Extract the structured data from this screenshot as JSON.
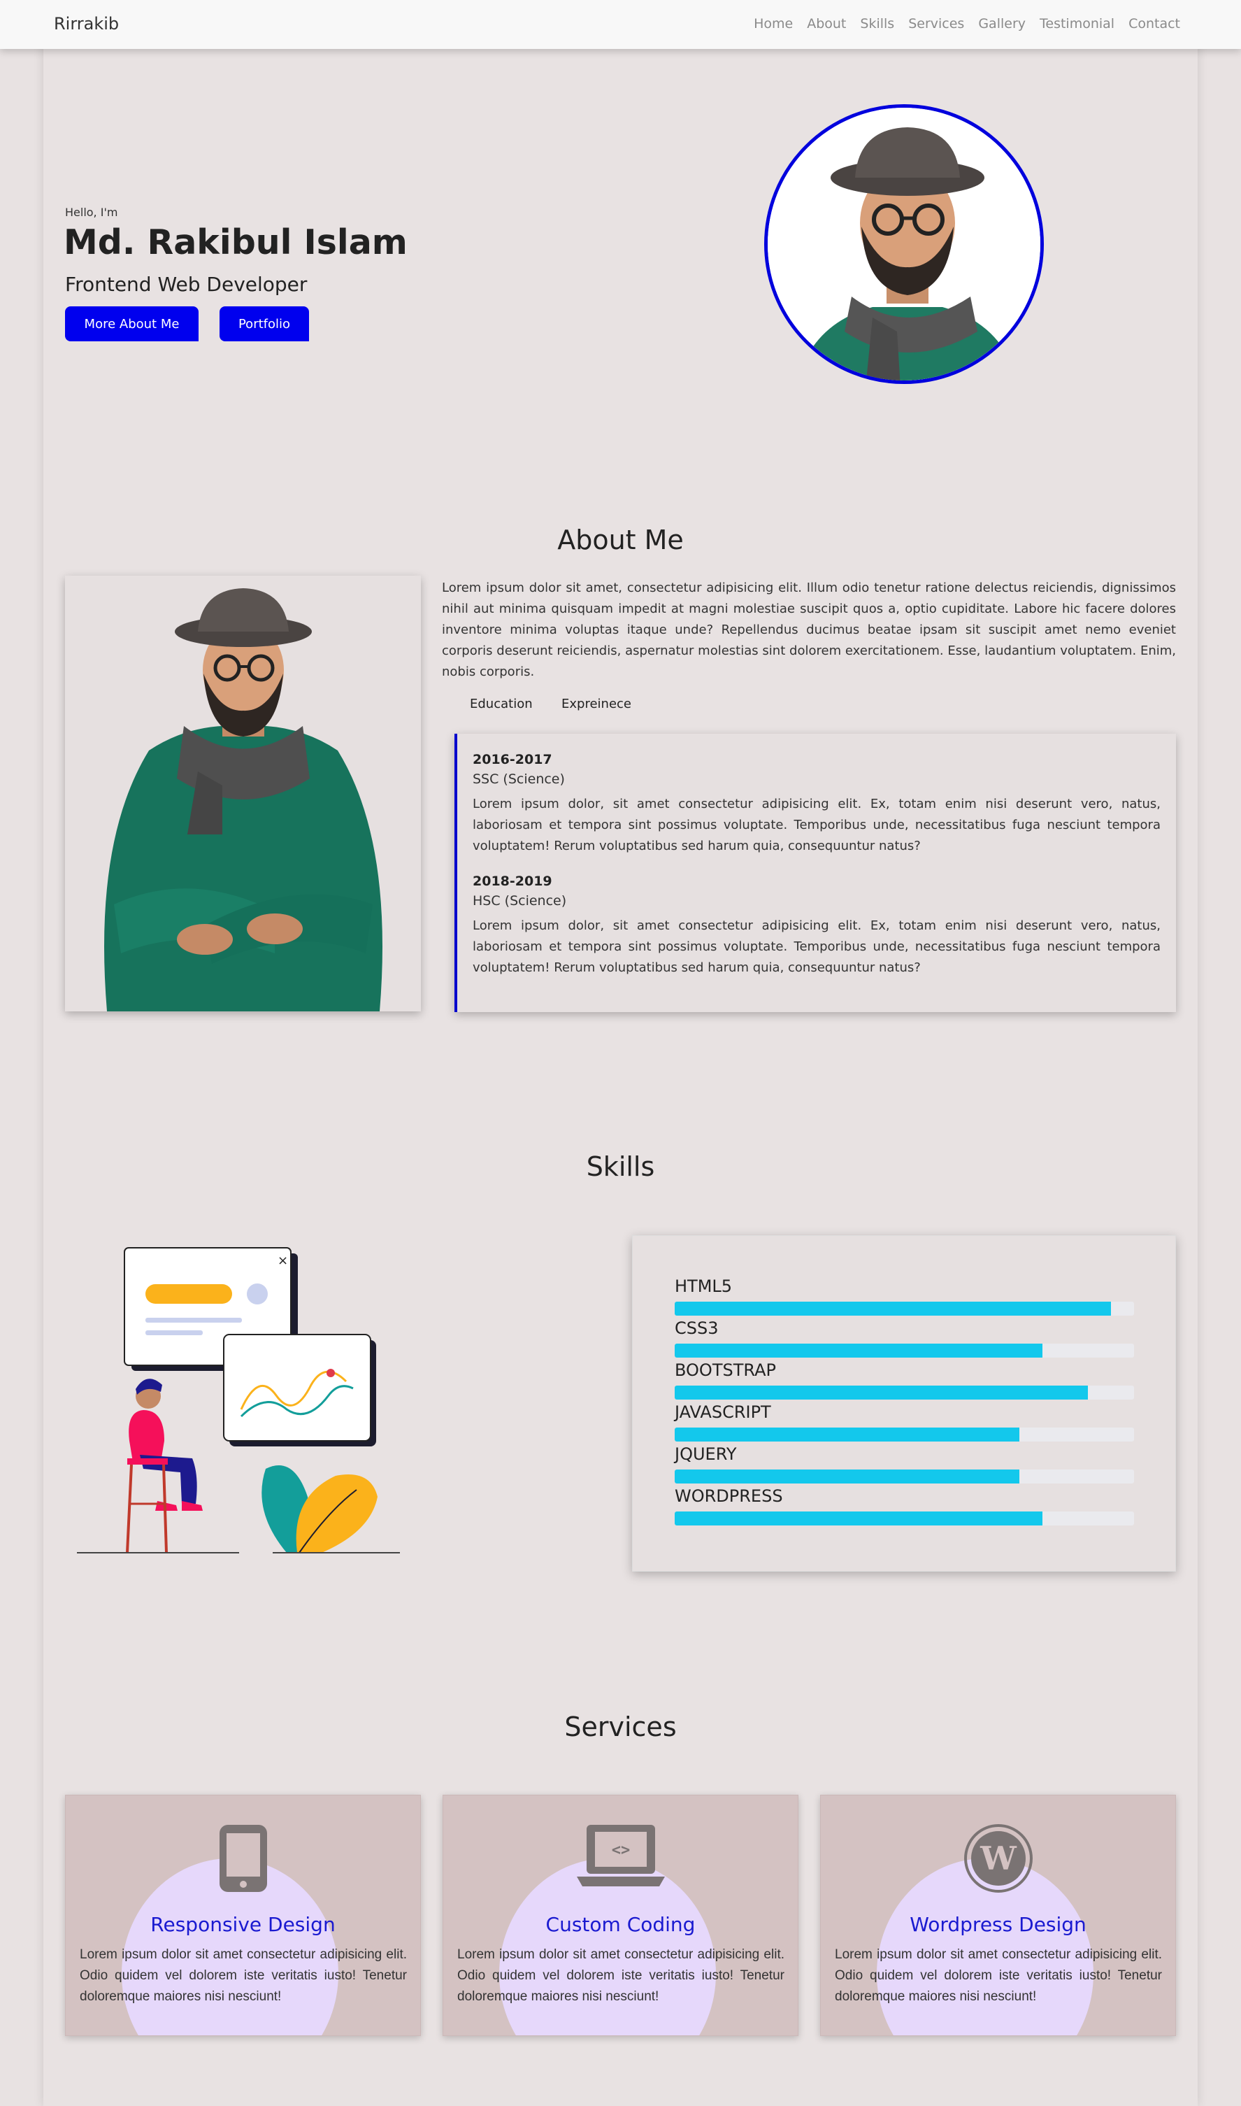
{
  "nav": {
    "brand": "Rirrakib",
    "links": [
      "Home",
      "About",
      "Skills",
      "Services",
      "Gallery",
      "Testimonial",
      "Contact"
    ]
  },
  "hero": {
    "greeting": "Hello, I'm",
    "name": "Md. Rakibul Islam",
    "role": "Frontend Web Developer",
    "more_button": "More About Me",
    "portfolio_button": "Portfolio"
  },
  "about": {
    "title": "About Me",
    "text": "Lorem ipsum dolor sit amet, consectetur adipisicing elit. Illum odio tenetur ratione delectus reiciendis, dignissimos nihil aut minima quisquam impedit at magni molestiae suscipit quos a, optio cupiditate. Labore hic facere dolores inventore minima voluptas itaque unde? Repellendus ducimus beatae ipsam sit suscipit amet nemo eveniet corporis deserunt reiciendis, aspernatur molestias sint dolorem exercitationem. Esse, laudantium voluptatem. Enim, nobis corporis.",
    "tabs": [
      "Education",
      "Expreinece"
    ],
    "education": [
      {
        "year": "2016-2017",
        "degree": "SSC (Science)",
        "desc": "Lorem ipsum dolor, sit amet consectetur adipisicing elit. Ex, totam enim nisi deserunt vero, natus, laboriosam et tempora sint possimus voluptate. Temporibus unde, necessitatibus fuga nesciunt tempora voluptatem! Rerum voluptatibus sed harum quia, consequuntur natus?"
      },
      {
        "year": "2018-2019",
        "degree": "HSC (Science)",
        "desc": "Lorem ipsum dolor, sit amet consectetur adipisicing elit. Ex, totam enim nisi deserunt vero, natus, laboriosam et tempora sint possimus voluptate. Temporibus unde, necessitatibus fuga nesciunt tempora voluptatem! Rerum voluptatibus sed harum quia, consequuntur natus?"
      }
    ]
  },
  "skills": {
    "title": "Skills",
    "items": [
      {
        "name": "HTML5",
        "level": 0.95
      },
      {
        "name": "CSS3",
        "level": 0.8
      },
      {
        "name": "BOOTSTRAP",
        "level": 0.9
      },
      {
        "name": "JAVASCRIPT",
        "level": 0.75
      },
      {
        "name": "JQUERY",
        "level": 0.75
      },
      {
        "name": "WORDPRESS",
        "level": 0.8
      }
    ],
    "bar_color": "#13c8ec"
  },
  "services": {
    "title": "Services",
    "items": [
      {
        "icon": "mobile-phone-icon",
        "title": "Responsive Design",
        "desc": "Lorem ipsum dolor sit amet consectetur adipisicing elit. Odio quidem vel dolorem iste veritatis iusto! Tenetur doloremque maiores nisi nesciunt!"
      },
      {
        "icon": "laptop-code-icon",
        "title": "Custom Coding",
        "desc": "Lorem ipsum dolor sit amet consectetur adipisicing elit. Odio quidem vel dolorem iste veritatis iusto! Tenetur doloremque maiores nisi nesciunt!"
      },
      {
        "icon": "wordpress-icon",
        "title": "Wordpress Design",
        "desc": "Lorem ipsum dolor sit amet consectetur adipisicing elit. Odio quidem vel dolorem iste veritatis iusto! Tenetur doloremque maiores nisi nesciunt!"
      }
    ]
  },
  "colors": {
    "accent": "#0000ee",
    "skill_bar": "#13c8ec",
    "service_title": "#1a1ad0"
  }
}
